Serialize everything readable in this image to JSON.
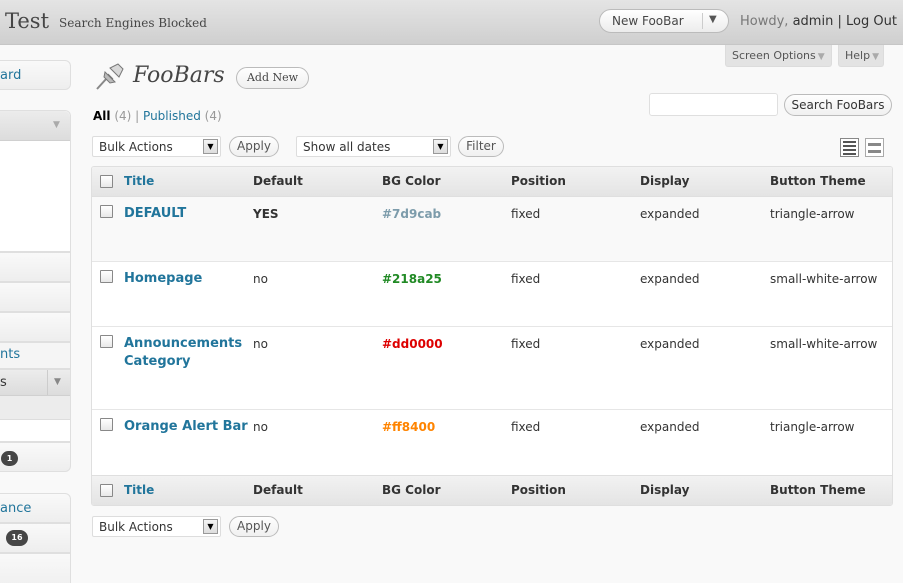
{
  "header": {
    "site_title": "Test",
    "site_status": "Search Engines Blocked",
    "favorite_action": "New FooBar",
    "howdy": "Howdy,",
    "user": "admin",
    "separator": "|",
    "logout": "Log Out"
  },
  "screen_meta": {
    "screen_options": "Screen Options",
    "help": "Help"
  },
  "sidebar": {
    "items": [
      "ard",
      "nts",
      "s",
      "ance"
    ],
    "badges": [
      "1",
      "16"
    ]
  },
  "page": {
    "title": "FooBars",
    "add_new": "Add New"
  },
  "filters": {
    "all_label": "All",
    "all_count": "(4)",
    "separator": "|",
    "published_label": "Published",
    "published_count": "(4)"
  },
  "search": {
    "placeholder": "",
    "button": "Search FooBars"
  },
  "tablenav": {
    "bulk_actions": "Bulk Actions",
    "apply": "Apply",
    "dates": "Show all dates",
    "filter": "Filter"
  },
  "table": {
    "columns": [
      "Title",
      "Default",
      "BG Color",
      "Position",
      "Display",
      "Button Theme"
    ],
    "rows": [
      {
        "title": "DEFAULT",
        "default": "YES",
        "bg_color": "#7d9cab",
        "position": "fixed",
        "display": "expanded",
        "theme": "triangle-arrow"
      },
      {
        "title": "Homepage",
        "default": "no",
        "bg_color": "#218a25",
        "position": "fixed",
        "display": "expanded",
        "theme": "small-white-arrow"
      },
      {
        "title": "Announcements Category",
        "default": "no",
        "bg_color": "#dd0000",
        "position": "fixed",
        "display": "expanded",
        "theme": "small-white-arrow"
      },
      {
        "title": "Orange Alert Bar",
        "default": "no",
        "bg_color": "#ff8400",
        "position": "fixed",
        "display": "expanded",
        "theme": "triangle-arrow"
      }
    ]
  },
  "colors": {
    "link": "#21759b",
    "header_bg": "#d9d9d9"
  }
}
